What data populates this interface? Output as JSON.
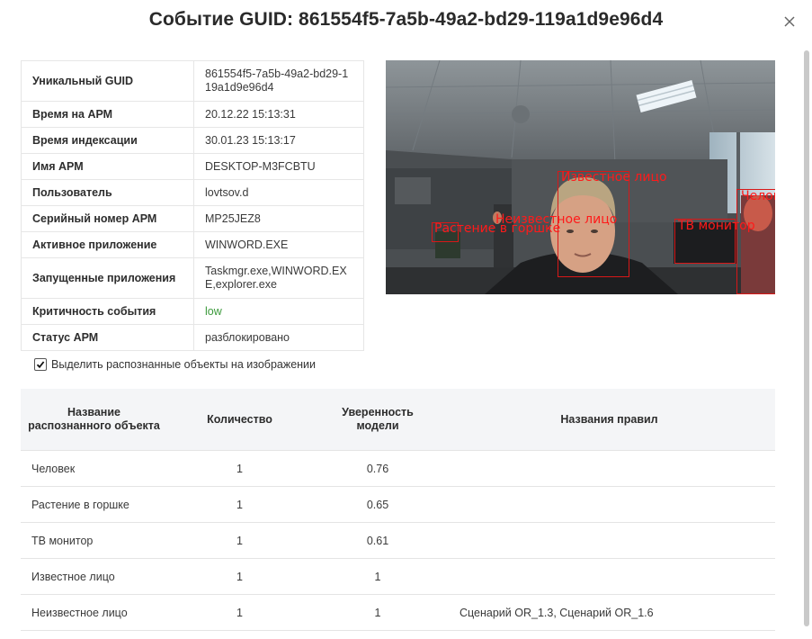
{
  "modal": {
    "title": "Событие GUID: 861554f5-7a5b-49a2-bd29-119a1d9e96d4"
  },
  "info": [
    {
      "label": "Уникальный GUID",
      "value": "861554f5-7a5b-49a2-bd29-119a1d9e96d4"
    },
    {
      "label": "Время на АРМ",
      "value": "20.12.22 15:13:31"
    },
    {
      "label": "Время индексации",
      "value": "30.01.23 15:13:17"
    },
    {
      "label": "Имя АРМ",
      "value": "DESKTOP-M3FCBTU"
    },
    {
      "label": "Пользователь",
      "value": "lovtsov.d"
    },
    {
      "label": "Серийный номер АРМ",
      "value": "MP25JEZ8"
    },
    {
      "label": "Активное приложение",
      "value": "WINWORD.EXE"
    },
    {
      "label": "Запущенные приложения",
      "value": "Taskmgr.exe,WINWORD.EXE,explorer.exe"
    },
    {
      "label": "Критичность события",
      "value": "low"
    },
    {
      "label": "Статус АРМ",
      "value": "разблокировано"
    }
  ],
  "detections": [
    {
      "label": "Известное лицо"
    },
    {
      "label": "Неизвестное лицо"
    },
    {
      "label": "Растение в горшке"
    },
    {
      "label": "ТВ монитор"
    },
    {
      "label": "Человек"
    }
  ],
  "highlight": {
    "label": "Выделить распознанные объекты на изображении",
    "checked": true
  },
  "objects_table": {
    "headers": [
      "Название распознанного объекта",
      "Количество",
      "Уверенность модели",
      "Названия правил"
    ],
    "rows": [
      {
        "name": "Человек",
        "count": "1",
        "confidence": "0.76",
        "rules": ""
      },
      {
        "name": "Растение в горшке",
        "count": "1",
        "confidence": "0.65",
        "rules": ""
      },
      {
        "name": "ТВ монитор",
        "count": "1",
        "confidence": "0.61",
        "rules": ""
      },
      {
        "name": "Известное лицо",
        "count": "1",
        "confidence": "1",
        "rules": ""
      },
      {
        "name": "Неизвестное лицо",
        "count": "1",
        "confidence": "1",
        "rules": "Сценарий OR_1.3, Сценарий OR_1.6"
      }
    ]
  },
  "colors": {
    "detection": "#d81818",
    "low_severity": "#3c9a3c",
    "header_bg": "#f4f5f7"
  },
  "icons": {
    "close": "close-icon",
    "checkbox": "checkmark-icon"
  }
}
